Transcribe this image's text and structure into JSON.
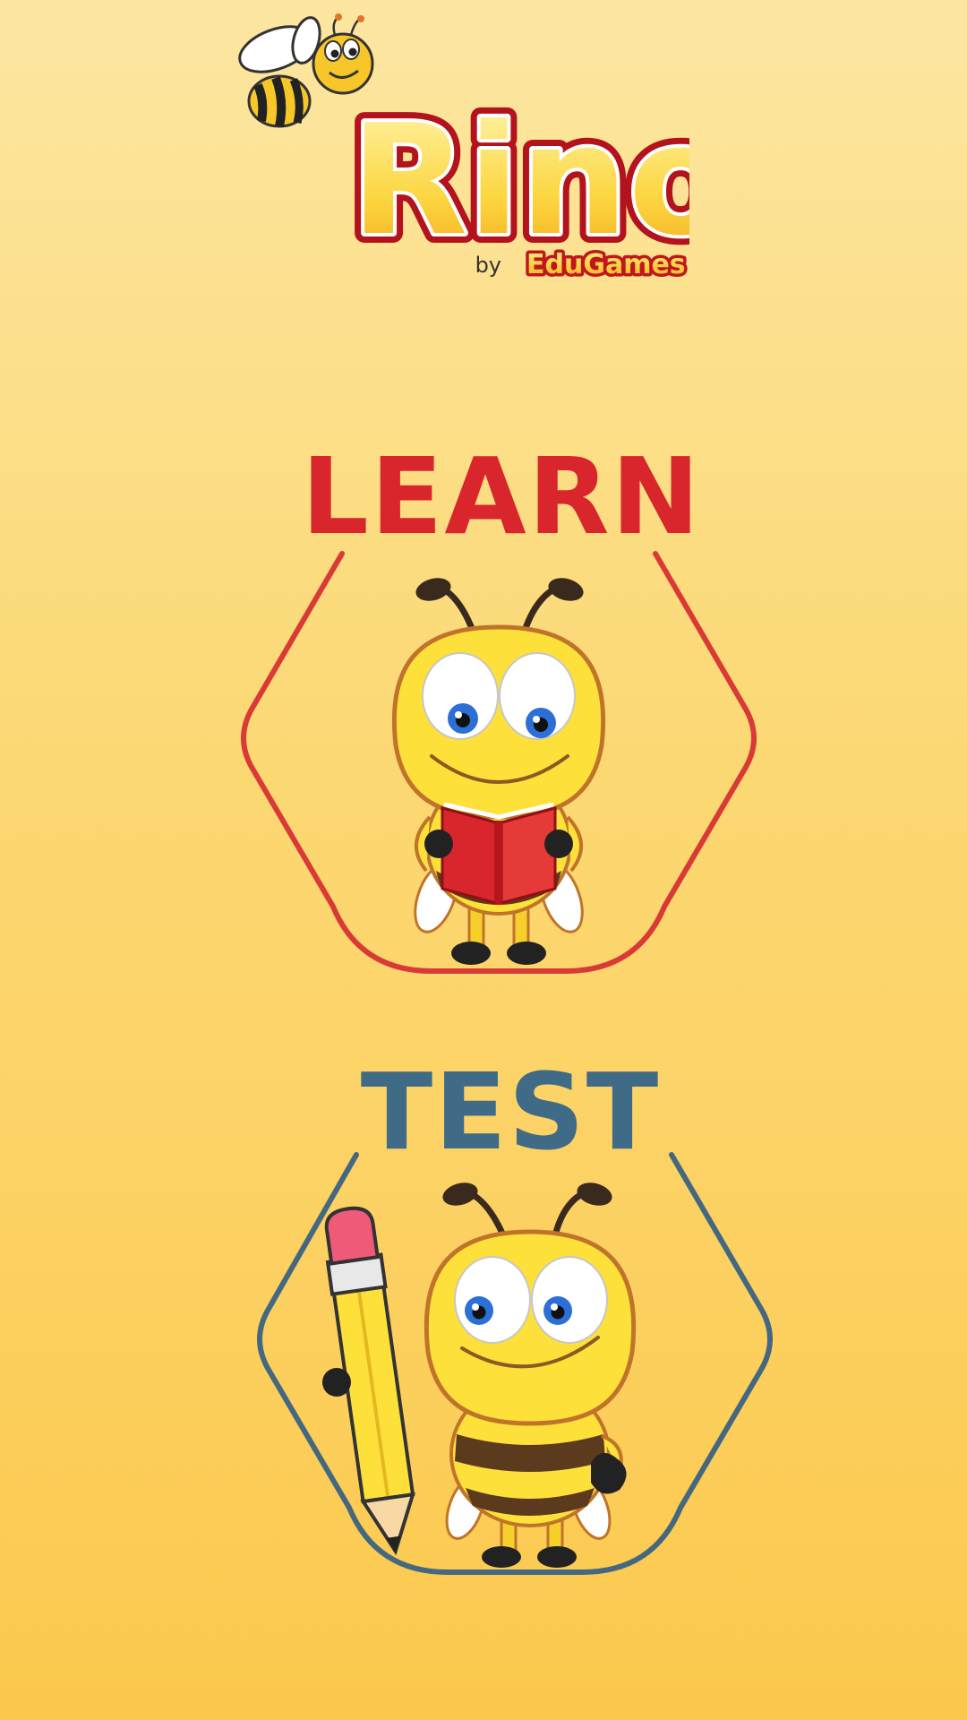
{
  "app": {
    "logo_text": "Rino",
    "byline_prefix": "by",
    "publisher": "EduGames"
  },
  "menu": {
    "learn": {
      "label": "LEARN",
      "color": "#d8262c",
      "mascot": "bee-reading-book-icon"
    },
    "test": {
      "label": "TEST",
      "color": "#3f6b86",
      "mascot": "bee-holding-pencil-icon"
    }
  },
  "colors": {
    "background_top": "#fce6a1",
    "background_bottom": "#fbc84c",
    "bee_yellow": "#fde03a",
    "bee_outline": "#c0742a"
  }
}
